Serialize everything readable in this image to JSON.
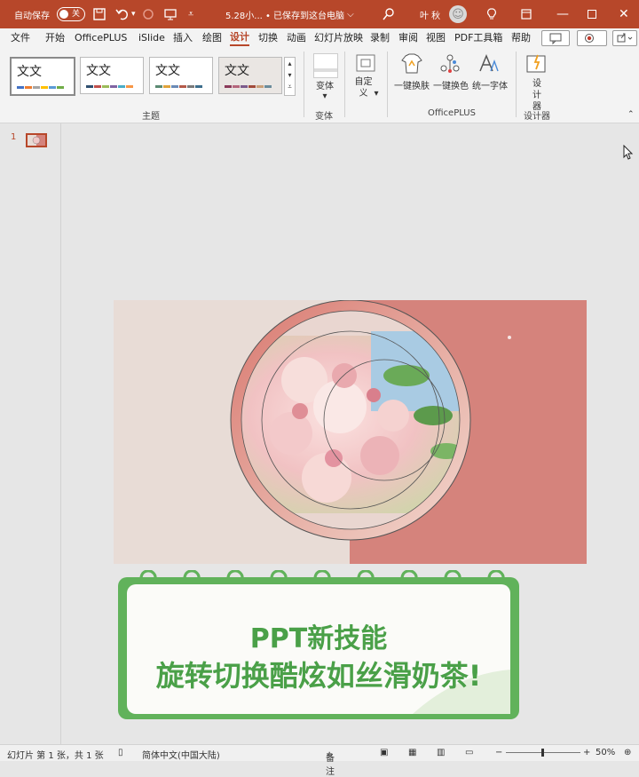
{
  "titlebar": {
    "autosave_label": "自动保存",
    "autosave_state": "关",
    "file_title": "5.28小... • 已保存到这台电脑",
    "user_name": "叶 秋"
  },
  "menu": {
    "tabs": [
      "文件",
      "开始",
      "OfficePLUS",
      "iSlide",
      "插入",
      "绘图",
      "设计",
      "切换",
      "动画",
      "幻灯片放映",
      "录制",
      "审阅",
      "视图",
      "PDF工具箱",
      "帮助"
    ],
    "active_tab": "设计"
  },
  "ribbon": {
    "theme_sample_text": "文文",
    "themes_group_label": "主题",
    "variant_button": "变体",
    "variant_group_label": "变体",
    "customize_button": "自定义",
    "officeplus_buttons": [
      "一键换肤",
      "一键换色",
      "统一字体"
    ],
    "officeplus_group_label": "OfficePLUS",
    "designer_button": "设计器",
    "designer_group_label": "设计器"
  },
  "thumbnails": {
    "slide_number": "1"
  },
  "card": {
    "title_line1": "PPT新技能",
    "title_line2": "旋转切换酷炫如丝滑奶茶!"
  },
  "statusbar": {
    "slide_info": "幻灯片 第 1 张，共 1 张",
    "language": "简体中文(中国大陆)",
    "notes": "备注",
    "zoom": "50%"
  },
  "colors": {
    "title_bar": "#b7472a",
    "slide_left": "#e8dcd6",
    "slide_right": "#d5837c",
    "card_green": "#61b25b",
    "card_text": "#4aa048"
  }
}
